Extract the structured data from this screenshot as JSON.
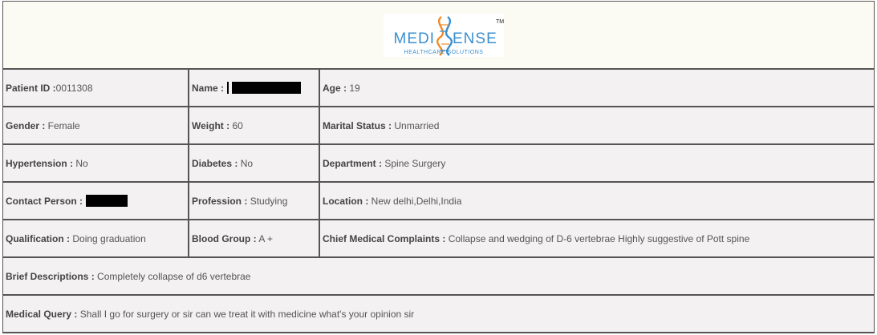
{
  "logo": {
    "brand_left": "MEDI",
    "brand_right": "ENSE",
    "tagline": "HEALTHCARE SOLUTIONS",
    "trademark": "TM",
    "colors": {
      "blue": "#3a8fd0",
      "orange": "#f08a2a"
    }
  },
  "patient": {
    "id_label": "Patient ID :",
    "id_value": "0011308",
    "name_label": "Name :",
    "age_label": "Age :",
    "age_value": " 19",
    "gender_label": "Gender :",
    "gender_value": " Female",
    "weight_label": "Weight :",
    "weight_value": " 60",
    "marital_label": "Marital Status :",
    "marital_value": " Unmarried",
    "hypertension_label": "Hypertension :",
    "hypertension_value": " No",
    "diabetes_label": "Diabetes :",
    "diabetes_value": " No",
    "department_label": "Department :",
    "department_value": " Spine Surgery",
    "contact_label": "Contact Person :",
    "profession_label": "Profession :",
    "profession_value": " Studying",
    "location_label": "Location :",
    "location_value": " New delhi,Delhi,India",
    "qualification_label": "Qualification :",
    "qualification_value": " Doing graduation",
    "blood_label": "Blood Group :",
    "blood_value": " A +",
    "complaints_label": "Chief Medical Complaints :",
    "complaints_value": " Collapse and wedging of D-6 vertebrae Highly suggestive of Pott spine",
    "brief_label": "Brief Descriptions :",
    "brief_value": " Completely collapse of d6 vertebrae",
    "query_label": "Medical Query :",
    "query_value": " Shall I go for surgery or sir can we treat it with medicine what's your opinion sir"
  }
}
